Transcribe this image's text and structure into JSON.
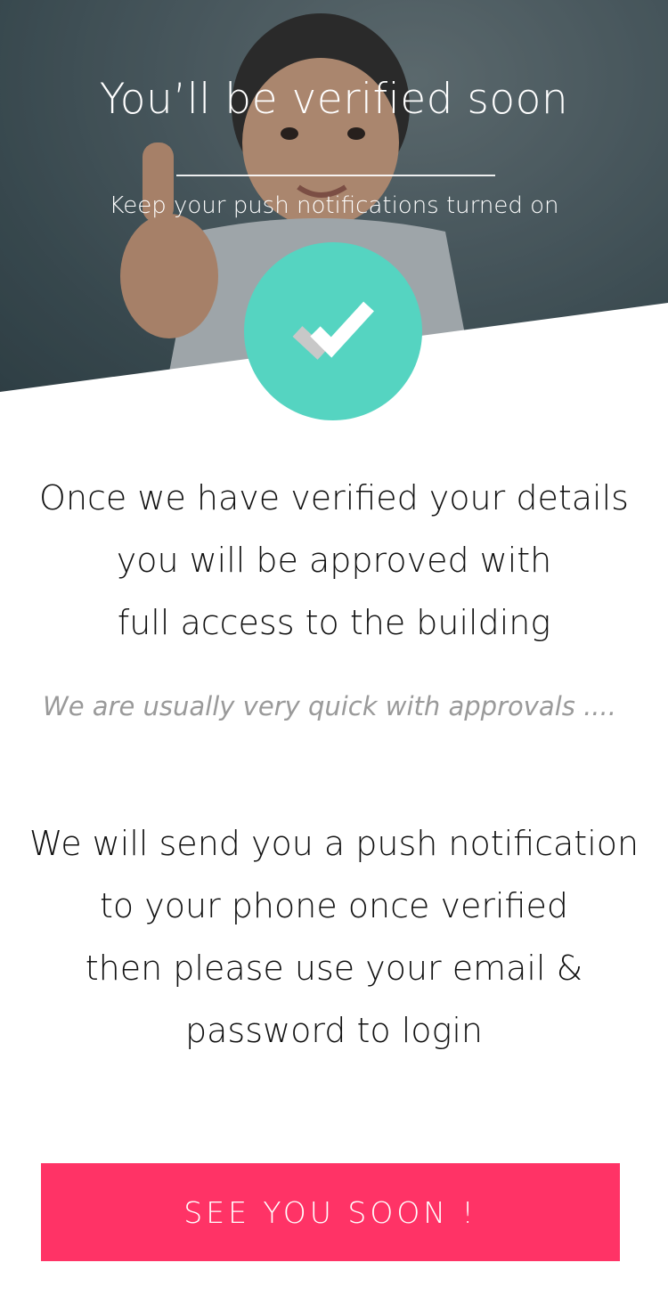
{
  "header": {
    "title": "You’ll be verified soon",
    "subtitle": "Keep your push notifications turned on"
  },
  "status_icon": {
    "icon": "checkmark-icon",
    "color": "#55d4c1"
  },
  "message_primary": {
    "lines": [
      "Once we have verified your details",
      "you will be approved with",
      "full access to the building"
    ]
  },
  "note": "We are usually very quick with approvals ....",
  "message_secondary": {
    "lines": [
      "We will send you a push notification",
      "to your phone once verified",
      "then please use your email &",
      "password to login"
    ]
  },
  "cta": {
    "label": "SEE YOU SOON !",
    "color": "#ff3366"
  }
}
